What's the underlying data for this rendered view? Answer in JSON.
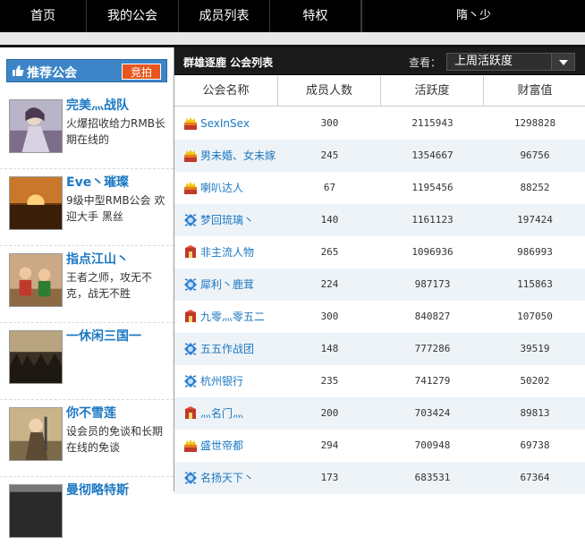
{
  "nav": {
    "items": [
      {
        "label": "首页"
      },
      {
        "label": "我的公会"
      },
      {
        "label": "成员列表"
      },
      {
        "label": "特权"
      }
    ],
    "user": "隋丶少"
  },
  "sidebar": {
    "title": "推荐公会",
    "auction_label": "竞拍",
    "guilds": [
      {
        "name": "完美灬战队",
        "desc": "火爆招收给力RMB长期在线的"
      },
      {
        "name": "Eve丶璀璨",
        "desc": "9级中型RMB公会 欢迎大手 黑丝"
      },
      {
        "name": "指点江山丶",
        "desc": "王者之师，攻无不克，战无不胜"
      },
      {
        "name": "一休闲三国一",
        "desc": ""
      },
      {
        "name": "你不雪莲",
        "desc": "设会员的免谈和长期在线的免谈"
      },
      {
        "name": "曼彻略特斯",
        "desc": ""
      }
    ]
  },
  "main": {
    "title": "群雄逐鹿 公会列表",
    "view_label": "查看：",
    "view_selected": "上周活跃度",
    "columns": [
      "公会名称",
      "成员人数",
      "活跃度",
      "财富值"
    ],
    "rows": [
      {
        "icon": "crown-chest-icon",
        "name": "SexInSex",
        "members": "300",
        "activity": "2115943",
        "wealth": "1298828"
      },
      {
        "icon": "crown-chest-icon",
        "name": "男未婚、女未嫁",
        "members": "245",
        "activity": "1354667",
        "wealth": "96756"
      },
      {
        "icon": "crown-chest-icon",
        "name": "喇叭达人",
        "members": "67",
        "activity": "1195456",
        "wealth": "88252"
      },
      {
        "icon": "blue-emblem-icon",
        "name": "梦回琉璃丶",
        "members": "140",
        "activity": "1161123",
        "wealth": "197424"
      },
      {
        "icon": "red-emblem-icon",
        "name": "非主流人物",
        "members": "265",
        "activity": "1096936",
        "wealth": "986993"
      },
      {
        "icon": "blue-emblem-icon",
        "name": "犀利丶鹿茸",
        "members": "224",
        "activity": "987173",
        "wealth": "115863"
      },
      {
        "icon": "red-emblem-icon",
        "name": "九零灬零五二",
        "members": "300",
        "activity": "840827",
        "wealth": "107050"
      },
      {
        "icon": "blue-emblem-icon",
        "name": "五五作战团",
        "members": "148",
        "activity": "777286",
        "wealth": "39519"
      },
      {
        "icon": "blue-emblem-icon",
        "name": "杭州银行",
        "members": "235",
        "activity": "741279",
        "wealth": "50202"
      },
      {
        "icon": "red-emblem-icon",
        "name": "灬名门灬",
        "members": "200",
        "activity": "703424",
        "wealth": "89813"
      },
      {
        "icon": "crown-chest-icon",
        "name": "盛世帝都",
        "members": "294",
        "activity": "700948",
        "wealth": "69738"
      },
      {
        "icon": "blue-emblem-icon",
        "name": "名扬天下丶",
        "members": "173",
        "activity": "683531",
        "wealth": "67364"
      }
    ]
  },
  "colors": {
    "link": "#1c78c2",
    "sidebar_header": "#3d85c6",
    "auction": "#e8561e",
    "row_alt": "#eef3f7"
  }
}
